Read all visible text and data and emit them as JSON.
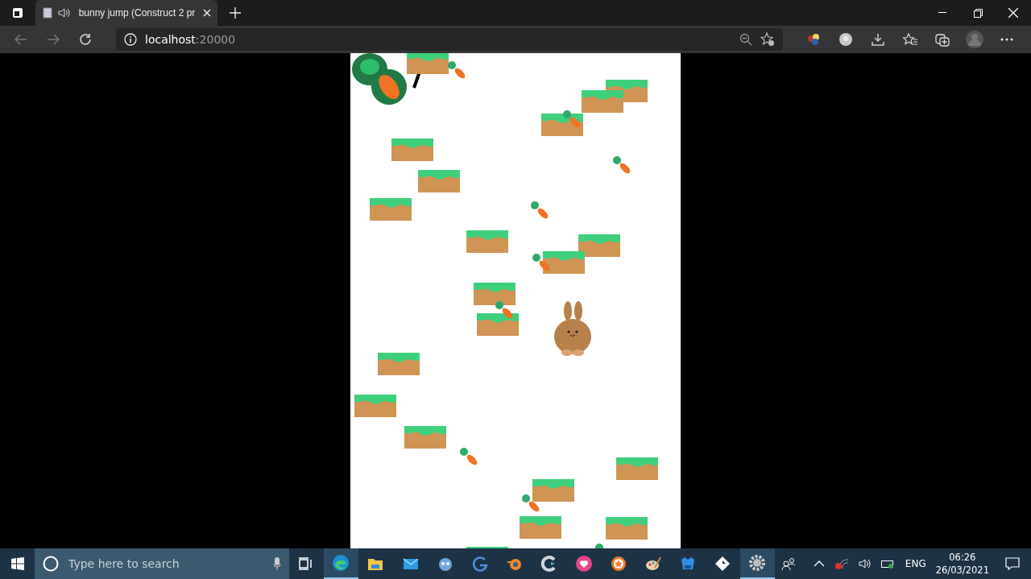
{
  "browser": {
    "tabs": [
      {
        "title": "bunny jump (Construct 2 pr",
        "selected": true,
        "audio": true
      }
    ],
    "address": {
      "host": "localhost",
      "port": ":20000"
    }
  },
  "taskbar": {
    "search": {
      "placeholder": "Type here to search"
    },
    "apps": [
      {
        "kind": "edge",
        "active": true
      },
      {
        "kind": "folder",
        "active": false
      },
      {
        "kind": "mail",
        "active": false
      },
      {
        "kind": "robot",
        "active": false
      },
      {
        "kind": "swirl",
        "active": false
      },
      {
        "kind": "blender",
        "active": false
      },
      {
        "kind": "c-logo",
        "active": false
      },
      {
        "kind": "heart",
        "active": false
      },
      {
        "kind": "star-ring",
        "active": false
      },
      {
        "kind": "palette",
        "active": false
      },
      {
        "kind": "shield",
        "active": false
      },
      {
        "kind": "diamond",
        "active": false
      },
      {
        "kind": "gear",
        "active": true
      }
    ],
    "language": "ENG",
    "time": "06:26",
    "date": "26/03/2021"
  }
}
